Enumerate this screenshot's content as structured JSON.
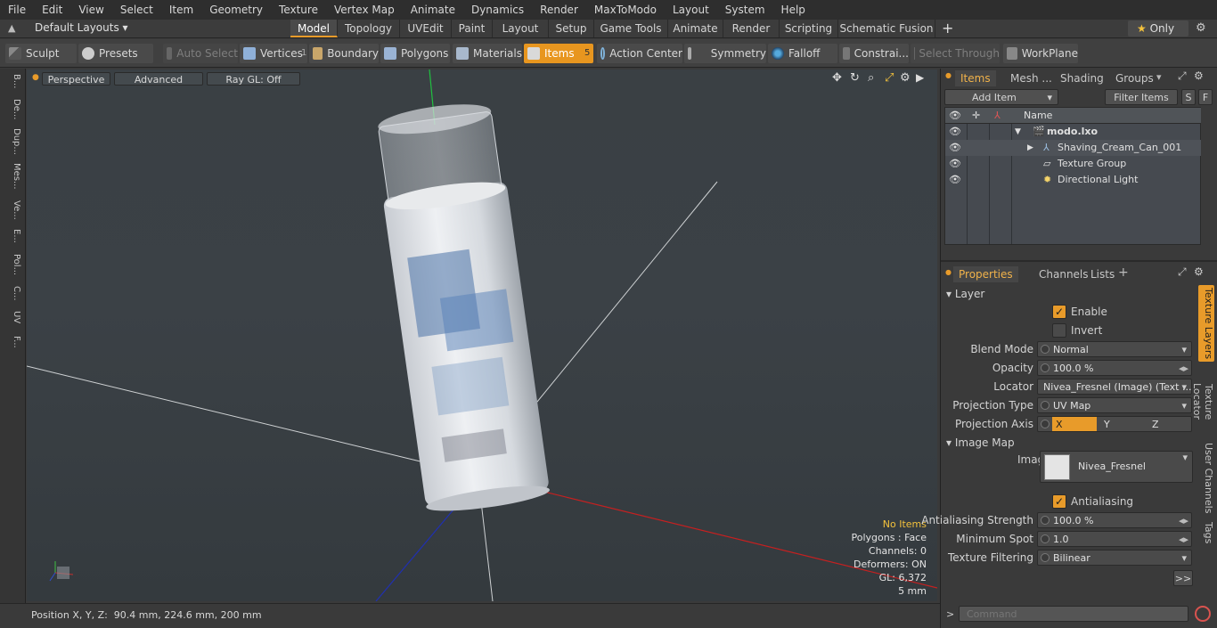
{
  "menu": [
    "File",
    "Edit",
    "View",
    "Select",
    "Item",
    "Geometry",
    "Texture",
    "Vertex Map",
    "Animate",
    "Dynamics",
    "Render",
    "MaxToModo",
    "Layout",
    "System",
    "Help"
  ],
  "layout_selector": "Default Layouts",
  "mode_tabs": [
    "Model",
    "Topology",
    "UVEdit",
    "Paint",
    "Layout",
    "Setup",
    "Game Tools",
    "Animate",
    "Render",
    "Scripting",
    "Schematic Fusion"
  ],
  "mode_active": "Model",
  "only_label": "Only",
  "toolbar": {
    "sculpt": "Sculpt",
    "presets": "Presets",
    "auto_select": "Auto Select",
    "vertices": "Vertices",
    "vertices_count": "1",
    "boundary": "Boundary",
    "polygons": "Polygons",
    "materials": "Materials",
    "items": "Items",
    "items_count": "5",
    "action_center": "Action Center",
    "symmetry": "Symmetry",
    "falloff": "Falloff",
    "constraints": "Constrai...",
    "select_through": "Select Through",
    "workplane": "WorkPlane"
  },
  "left_tabs": [
    "B...",
    "De...",
    "Dup...",
    "Mes...",
    "Ve...",
    "E...",
    "Pol...",
    "C...",
    "UV",
    "F..."
  ],
  "viewport": {
    "perspective": "Perspective",
    "advanced": "Advanced",
    "raygl": "Ray GL: Off",
    "hud": {
      "no_items": "No Items",
      "polygons": "Polygons : Face",
      "channels": "Channels: 0",
      "deformers": "Deformers: ON",
      "gl": "GL: 6,372",
      "scale": "5 mm"
    }
  },
  "status": "Position X, Y, Z:  90.4 mm, 224.6 mm, 200 mm",
  "items_panel": {
    "tabs": [
      "Items",
      "Mesh ...",
      "Shading",
      "Groups"
    ],
    "add_item": "Add Item",
    "filter_items": "Filter Items",
    "s_btn": "S",
    "f_btn": "F",
    "col_name": "Name",
    "rows": [
      "modo.lxo",
      "Shaving_Cream_Can_001",
      "Texture Group",
      "Directional Light"
    ]
  },
  "props_panel": {
    "tabs": [
      "Properties",
      "Channels",
      "Lists"
    ],
    "layer_section": "Layer",
    "enable": "Enable",
    "invert": "Invert",
    "blend_mode_label": "Blend Mode",
    "blend_mode": "Normal",
    "opacity_label": "Opacity",
    "opacity": "100.0 %",
    "locator_label": "Locator",
    "locator": "Nivea_Fresnel (Image) (Text ...",
    "projection_type_label": "Projection Type",
    "projection_type": "UV Map",
    "projection_axis_label": "Projection Axis",
    "axis_x": "X",
    "axis_y": "Y",
    "axis_z": "Z",
    "image_map_section": "Image Map",
    "image_label": "Image",
    "image": "Nivea_Fresnel",
    "antialiasing": "Antialiasing",
    "aa_strength_label": "Antialiasing Strength",
    "aa_strength": "100.0 %",
    "min_spot_label": "Minimum Spot",
    "min_spot": "1.0",
    "tex_filter_label": "Texture Filtering",
    "tex_filter": "Bilinear",
    "more": ">>",
    "side_tabs": [
      "Texture Layers",
      "Texture Locator",
      "User Channels",
      "Tags"
    ]
  },
  "command_placeholder": "Command",
  "colors": {
    "accent": "#e89b2a",
    "viewport_bg": "#3a4044"
  }
}
